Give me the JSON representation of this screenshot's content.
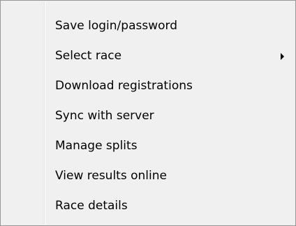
{
  "menu": {
    "items": [
      {
        "label": "Save login/password",
        "submenu": false
      },
      {
        "label": "Select race",
        "submenu": true
      },
      {
        "label": "Download registrations",
        "submenu": false
      },
      {
        "label": "Sync with server",
        "submenu": false
      },
      {
        "label": "Manage splits",
        "submenu": false
      },
      {
        "label": "View results online",
        "submenu": false
      },
      {
        "label": "Race details",
        "submenu": false
      }
    ]
  },
  "icons": {
    "submenu_arrow": "chevron-right-icon"
  },
  "colors": {
    "menu_background": "#f0f0f0",
    "menu_border": "#979797",
    "gutter_separator": "#e2e3e3",
    "text": "#000000"
  }
}
